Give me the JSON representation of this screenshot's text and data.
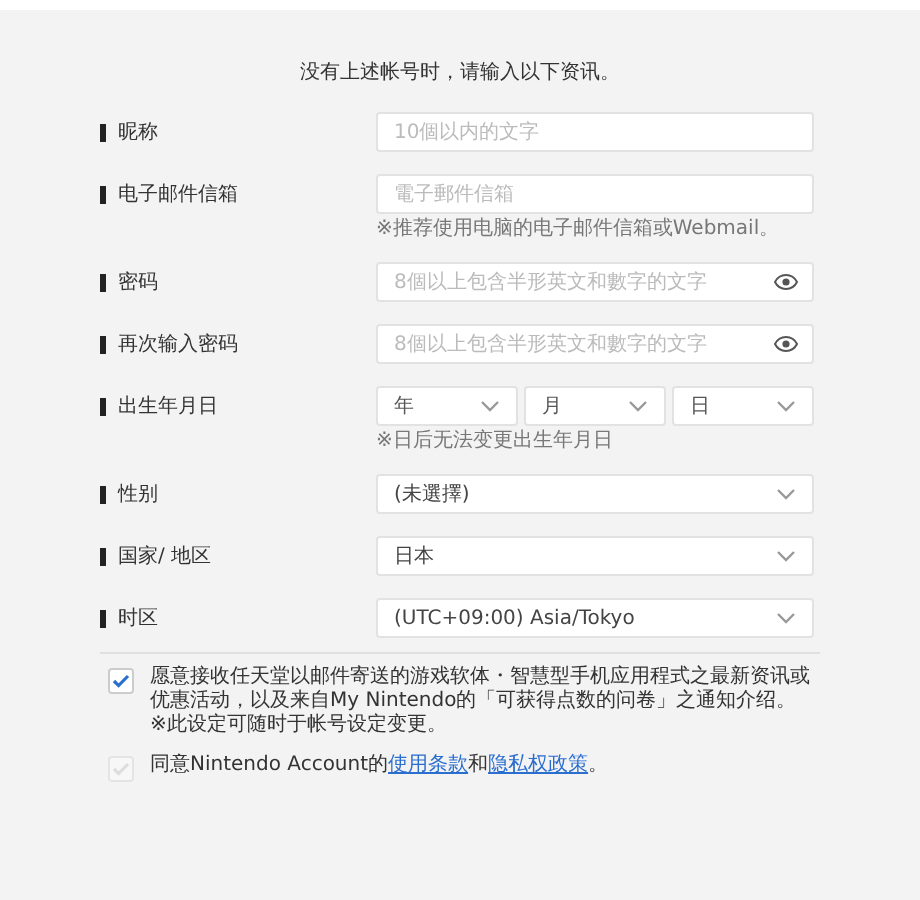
{
  "intro": "没有上述帐号时，请输入以下资讯。",
  "fields": [
    {
      "kind": "text",
      "label": "昵称",
      "placeholder": "10個以内的文字"
    },
    {
      "kind": "text",
      "label": "电子邮件信箱",
      "placeholder": "電子郵件信箱",
      "hint": "※推荐使用电脑的电子邮件信箱或Webmail。"
    },
    {
      "kind": "password",
      "label": "密码",
      "placeholder": "8個以上包含半形英文和數字的文字"
    },
    {
      "kind": "password",
      "label": "再次输入密码",
      "placeholder": "8個以上包含半形英文和數字的文字"
    },
    {
      "kind": "date",
      "label": "出生年月日",
      "parts": [
        "年",
        "月",
        "日"
      ],
      "hint": "※日后无法变更出生年月日"
    },
    {
      "kind": "select",
      "label": "性别",
      "value": "(未選擇)"
    },
    {
      "kind": "select",
      "label": "国家/ 地区",
      "value": "日本"
    },
    {
      "kind": "select",
      "label": "时区",
      "value": "(UTC+09:00) Asia/Tokyo"
    }
  ],
  "agreements": [
    {
      "checked": true,
      "text": "愿意接收任天堂以邮件寄送的游戏软体・智慧型手机应用程式之最新资讯或优惠活动，以及来自My Nintendo的「可获得点数的问卷」之通知介绍。",
      "note": "※此设定可随时于帐号设定变更。"
    },
    {
      "checked": false,
      "before": "同意Nintendo Account的",
      "links": [
        "使用条款",
        "隐私权政策"
      ],
      "joiner": "和",
      "after": "。"
    }
  ]
}
